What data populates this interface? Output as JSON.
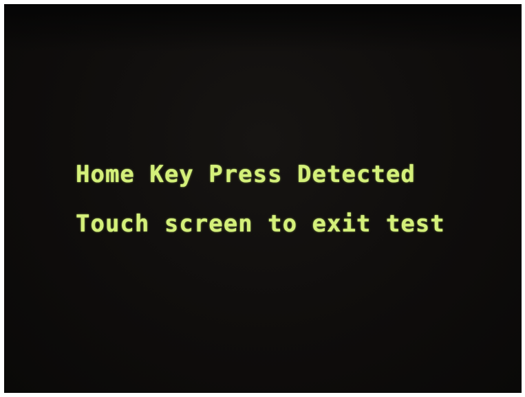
{
  "screen": {
    "background_color": "#0f0d0c",
    "text_color": "#d4f07a",
    "lines": [
      "Home Key Press Detected",
      "Touch screen to exit test"
    ]
  }
}
